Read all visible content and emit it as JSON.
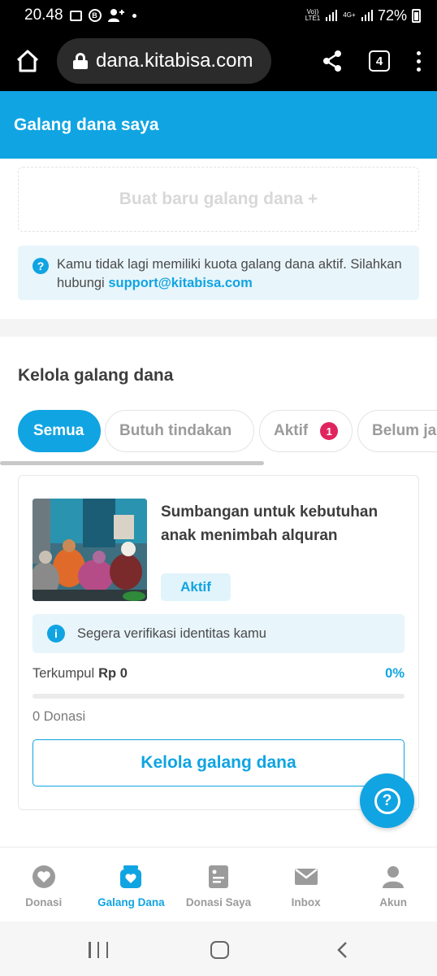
{
  "status_bar": {
    "time": "20.48",
    "network_label": "Vo)) LTE1",
    "network_4g": "4G+",
    "battery": "72%"
  },
  "browser": {
    "url": "dana.kitabisa.com",
    "tab_count": "4"
  },
  "header": {
    "title": "Galang dana saya"
  },
  "create": {
    "label": "Buat baru galang dana +"
  },
  "quota_notice": {
    "text": "Kamu tidak lagi memiliki kuota galang dana aktif. Silahkan hubungi ",
    "link": "support@kitabisa.com"
  },
  "manage_section": {
    "title": "Kelola galang dana",
    "tabs": [
      {
        "label": "Semua",
        "active": true
      },
      {
        "label": "Butuh tindakan",
        "active": false
      },
      {
        "label": "Aktif",
        "badge": "1",
        "active": false
      },
      {
        "label": "Belum ja",
        "active": false
      }
    ]
  },
  "campaign": {
    "title": "Sumbangan untuk kebutuhan anak menimbah alquran",
    "status": "Aktif",
    "notice": "Segera verifikasi identitas kamu",
    "raised_label": "Terkumpul",
    "raised_amount": "Rp 0",
    "progress_text": "0%",
    "progress_value": 0,
    "donations": "0 Donasi",
    "manage_button": "Kelola galang dana"
  },
  "help": {
    "icon": "question-icon"
  },
  "bottom_nav": [
    {
      "label": "Donasi",
      "icon": "heart-icon",
      "active": false
    },
    {
      "label": "Galang Dana",
      "icon": "jar-heart-icon",
      "active": true
    },
    {
      "label": "Donasi Saya",
      "icon": "document-icon",
      "active": false
    },
    {
      "label": "Inbox",
      "icon": "mail-icon",
      "active": false
    },
    {
      "label": "Akun",
      "icon": "user-icon",
      "active": false
    }
  ],
  "colors": {
    "brand": "#10a4e2",
    "badge": "#e0245e"
  }
}
